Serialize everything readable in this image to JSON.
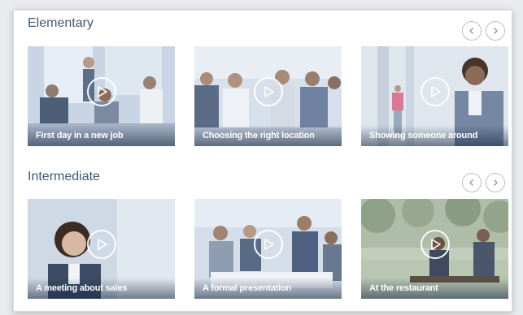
{
  "sections": [
    {
      "title": "Elementary",
      "items": [
        {
          "label": "First day in a new job"
        },
        {
          "label": "Choosing the right location"
        },
        {
          "label": "Showing someone around"
        }
      ]
    },
    {
      "title": "Intermediate",
      "items": [
        {
          "label": "A meeting about sales"
        },
        {
          "label": "A formal presentation"
        },
        {
          "label": "At the restaurant"
        }
      ]
    }
  ],
  "icons": {
    "prev": "chevron-left-icon",
    "next": "chevron-right-icon",
    "play": "play-icon"
  },
  "colors": {
    "title": "#3f5a73",
    "arrow_border": "#b9c0c9"
  }
}
